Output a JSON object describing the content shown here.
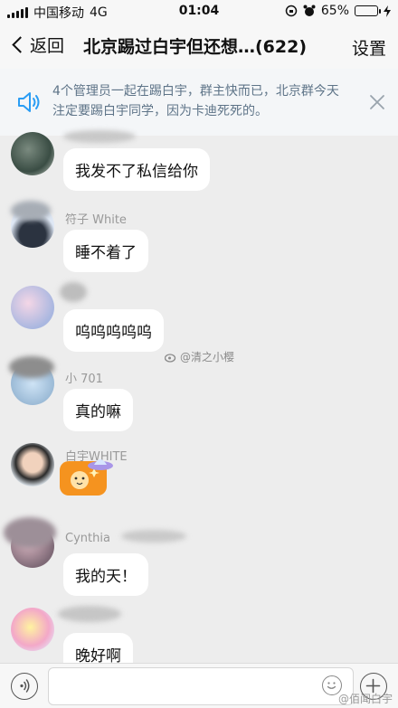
{
  "status_bar": {
    "carrier": "中国移动",
    "network": "4G",
    "time": "01:04",
    "battery": "65%",
    "battery_level": 0.65,
    "battery_color": "#4cd964"
  },
  "nav": {
    "back_label": "返回",
    "title": "北京踢过白宇但还想…(622)",
    "settings_label": "设置"
  },
  "notice": {
    "text": "4个管理员一起在踢白宇，群主快而已，北京群今天注定要踢白宇同学，因为卡迪死死的。",
    "icon": "speaker-icon",
    "close_icon": "close-icon"
  },
  "messages": [
    {
      "nickname": "",
      "text": "我发不了私信给你"
    },
    {
      "nickname": "符子 White",
      "text": "睡不着了"
    },
    {
      "nickname": "",
      "text": "呜呜呜呜呜"
    },
    {
      "nickname": "小 701",
      "text": "真的嘛"
    },
    {
      "nickname": "白宇WHITE",
      "text": "",
      "sticker": "cat-emoji-sticker"
    },
    {
      "nickname": "Cynthia",
      "text": "我的天！"
    },
    {
      "nickname": "",
      "text": "晚好啊"
    }
  ],
  "watermarks": {
    "center": "@清之小樱",
    "bottom": "@佰闻白宇"
  },
  "input_bar": {
    "voice_icon": "voice-icon",
    "emoji_icon": "emoji-icon",
    "plus_icon": "plus-icon"
  },
  "colors": {
    "notice_text": "#5e7488",
    "notice_icon": "#2a9df4",
    "sticker_bg": "#f5931f"
  }
}
